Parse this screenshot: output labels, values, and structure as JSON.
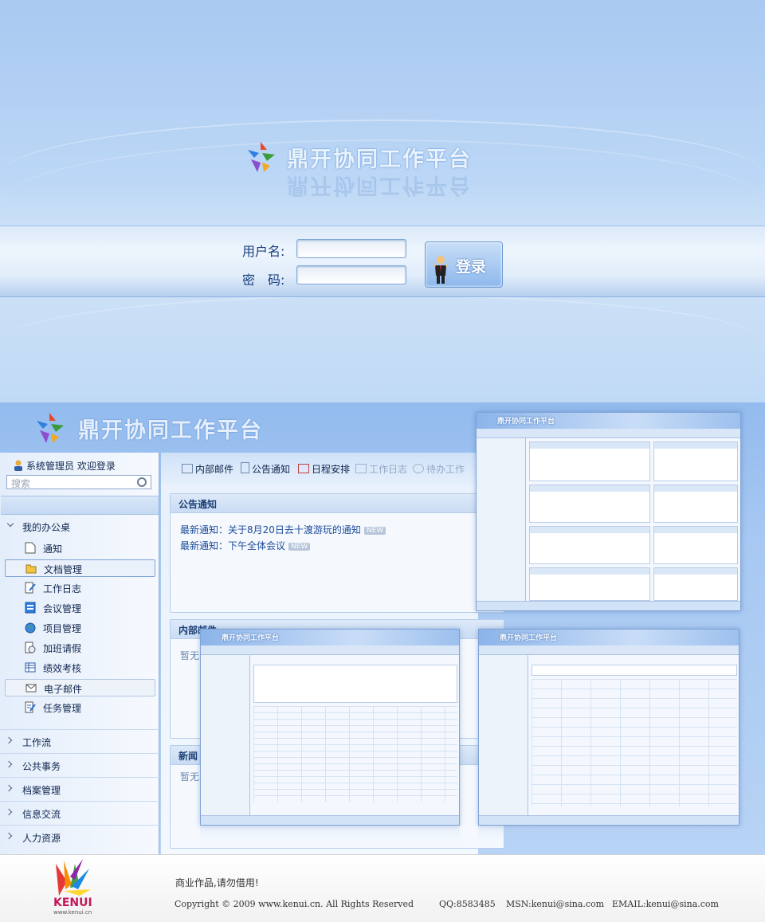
{
  "login": {
    "title": "鼎开协同工作平台",
    "username_label": "用户名:",
    "password_label": "密　码:",
    "login_button": "登录"
  },
  "preview": {
    "title": "鼎开协同工作平台",
    "user": "系统管理员 欢迎登录",
    "search_placeholder": "搜索",
    "toolbar": [
      "内部邮件",
      "公告通知",
      "日程安排",
      "工作日志",
      "待办工作"
    ],
    "nav_open_group": "我的办公桌",
    "nav_items": [
      "通知",
      "文档管理",
      "工作日志",
      "会议管理",
      "项目管理",
      "加班请假",
      "绩效考核",
      "电子邮件",
      "任务管理"
    ],
    "nav_groups": [
      "工作流",
      "公共事务",
      "档案管理",
      "信息交流",
      "人力资源"
    ],
    "panels": {
      "notice_title": "公告通知",
      "notices": [
        "最新通知：关于8月20日去十渡游玩的通知",
        "最新通知：下午全体会议"
      ],
      "new_badge": "NEW",
      "mail_title": "内部邮件",
      "mail_empty": "暂无",
      "news_title": "新闻",
      "news_empty": "暂无"
    },
    "thumb_title": "鼎开协同工作平台"
  },
  "footer": {
    "brand": "KENUI",
    "brand_url": "www.kenui.cn",
    "notice": "商业作品,请勿借用!",
    "copyright": "Copyright © 2009 www.kenui.cn. All Rights Reserved",
    "qq": "QQ:8583485",
    "msn": "MSN:kenui@sina.com",
    "email": "EMAIL:kenui@sina.com"
  },
  "colors": {
    "accent": "#1c3f75",
    "background": "#a9c9f1",
    "panel": "#f5f9fe"
  }
}
